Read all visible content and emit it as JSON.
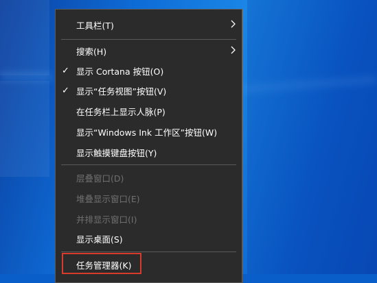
{
  "menu": {
    "items": [
      {
        "label": "工具栏(T)"
      },
      {
        "label": "搜索(H)"
      },
      {
        "label": "显示 Cortana 按钮(O)",
        "checked": true
      },
      {
        "label": "显示“任务视图”按钮(V)",
        "checked": true
      },
      {
        "label": "在任务栏上显示人脉(P)"
      },
      {
        "label": "显示“Windows Ink 工作区”按钮(W)"
      },
      {
        "label": "显示触摸键盘按钮(Y)"
      },
      {
        "label": "层叠窗口(D)",
        "disabled": true
      },
      {
        "label": "堆叠显示窗口(E)",
        "disabled": true
      },
      {
        "label": "并排显示窗口(I)",
        "disabled": true
      },
      {
        "label": "显示桌面(S)"
      },
      {
        "label": "任务管理器(K)"
      }
    ],
    "check_glyph": "✓"
  },
  "colors": {
    "menu_bg": "#2b2b2b",
    "disabled_text": "#707070",
    "highlight_border": "#d83a2c",
    "desktop_blue": "#0e6bd6"
  }
}
